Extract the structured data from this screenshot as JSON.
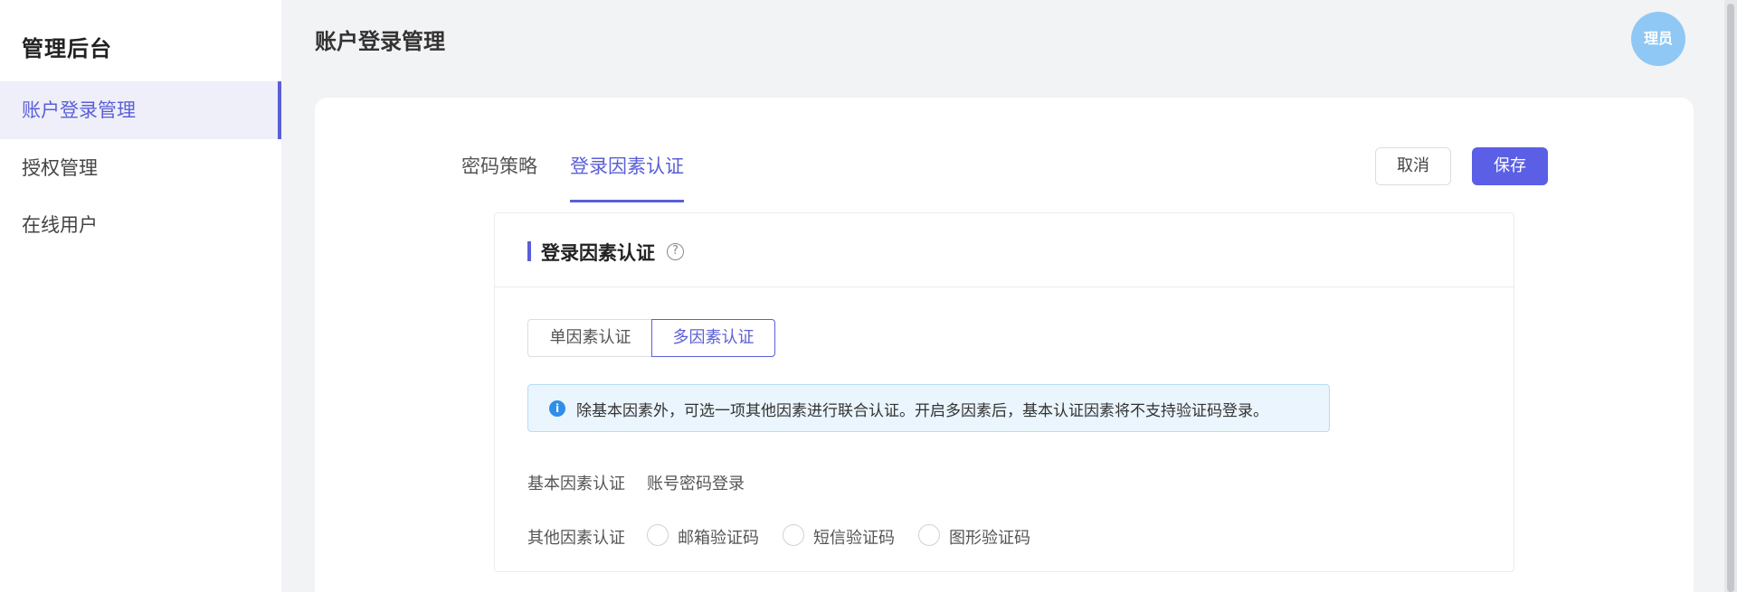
{
  "sidebar": {
    "brand": "管理后台",
    "items": [
      {
        "label": "账户登录管理",
        "active": true
      },
      {
        "label": "授权管理",
        "active": false
      },
      {
        "label": "在线用户",
        "active": false
      }
    ]
  },
  "header": {
    "title": "账户登录管理",
    "avatar_text": "理员"
  },
  "tabs": [
    {
      "label": "密码策略",
      "active": false
    },
    {
      "label": "登录因素认证",
      "active": true
    }
  ],
  "actions": {
    "cancel_label": "取消",
    "save_label": "保存"
  },
  "panel": {
    "title": "登录因素认证",
    "help_icon": "question-circle-icon",
    "segments": [
      {
        "label": "单因素认证",
        "active": false
      },
      {
        "label": "多因素认证",
        "active": true
      }
    ],
    "notice": {
      "icon": "info-icon",
      "text": "除基本因素外，可选一项其他因素进行联合认证。开启多因素后，基本认证因素将不支持验证码登录。"
    },
    "basic": {
      "label": "基本因素认证",
      "value": "账号密码登录"
    },
    "other": {
      "label": "其他因素认证",
      "options": [
        {
          "label": "邮箱验证码",
          "checked": false
        },
        {
          "label": "短信验证码",
          "checked": false
        },
        {
          "label": "图形验证码",
          "checked": false
        }
      ]
    }
  },
  "colors": {
    "accent": "#5b5fd6",
    "primary_button": "#5b5fe6",
    "avatar": "#8fc8f4",
    "info": "#2f8ee8"
  }
}
